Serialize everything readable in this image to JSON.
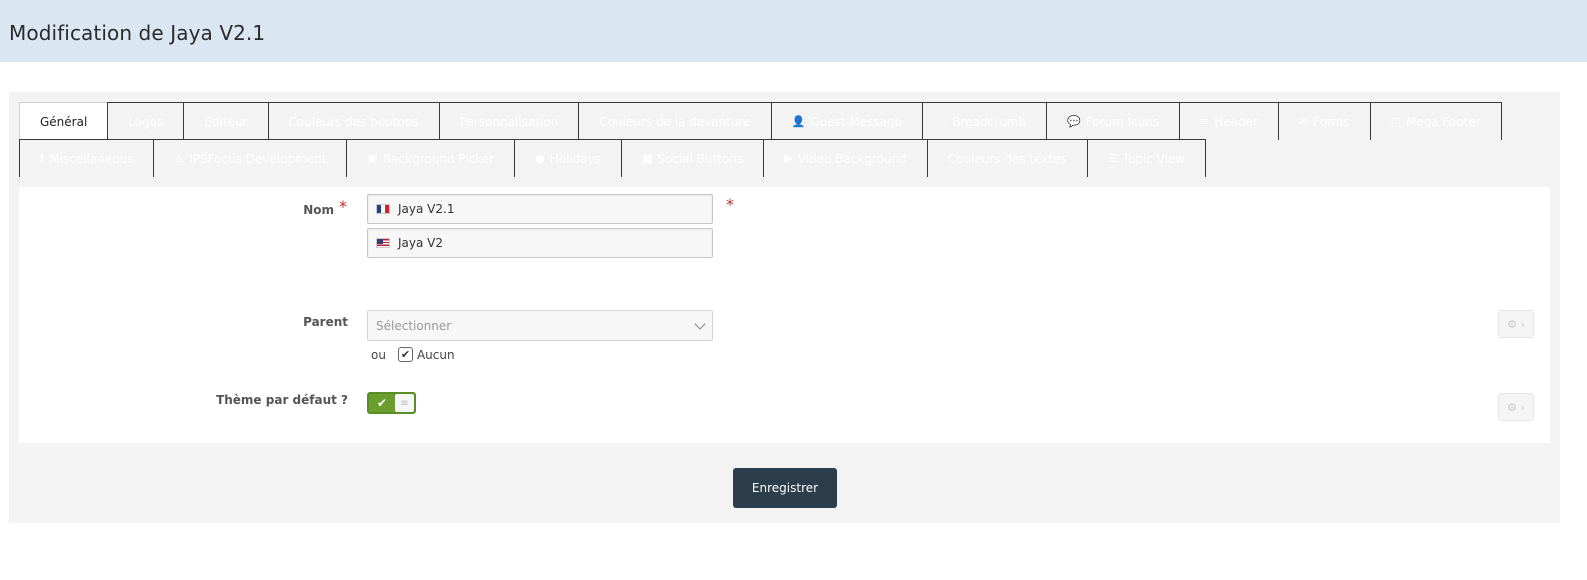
{
  "header": {
    "title": "Modification de Jaya V2.1"
  },
  "tabs_row1": [
    {
      "label": "Général",
      "icon": ""
    },
    {
      "label": "Logos",
      "icon": ""
    },
    {
      "label": "Editeur",
      "icon": ""
    },
    {
      "label": "Couleurs des boutons",
      "icon": ""
    },
    {
      "label": "Personnalisation",
      "icon": ""
    },
    {
      "label": "Couleurs de la devanture",
      "icon": ""
    },
    {
      "label": "Guest Message",
      "icon": "👤"
    },
    {
      "label": "Breadcrumb",
      "icon": "›"
    },
    {
      "label": "Forum Icons",
      "icon": "💬"
    },
    {
      "label": "Header",
      "icon": "≡"
    },
    {
      "label": "Forms",
      "icon": "✉"
    },
    {
      "label": "Mega Footer",
      "icon": "□"
    }
  ],
  "tabs_row2": [
    {
      "label": "Miscellaneous",
      "icon": "ℹ"
    },
    {
      "label": "IPSFocus Development",
      "icon": "⚠"
    },
    {
      "label": "Background Picker",
      "icon": "▣"
    },
    {
      "label": "Holidays",
      "icon": "●"
    },
    {
      "label": "Social Buttons",
      "icon": "■"
    },
    {
      "label": "Video Background",
      "icon": "▶"
    },
    {
      "label": "Couleurs des textes",
      "icon": ""
    },
    {
      "label": "Topic View",
      "icon": "☰"
    }
  ],
  "form": {
    "name_label": "Nom",
    "name_fr": "Jaya V2.1",
    "name_en": "Jaya V2",
    "required_mark": "*",
    "parent_label": "Parent",
    "parent_placeholder": "Sélectionner",
    "ou_label": "ou",
    "none_label": "Aucun",
    "none_checked": true,
    "default_theme_label": "Thème par défaut ?",
    "default_theme_on": true
  },
  "icons": {
    "check": "✔",
    "gear": "⚙ ›",
    "toggle_knob": "≡"
  },
  "footer": {
    "save_label": "Enregistrer"
  },
  "colors": {
    "header_bg": "#dae6f1",
    "save_bg": "#2c3d4b",
    "toggle_green": "#6b9e2e",
    "required_red": "#c03030"
  }
}
